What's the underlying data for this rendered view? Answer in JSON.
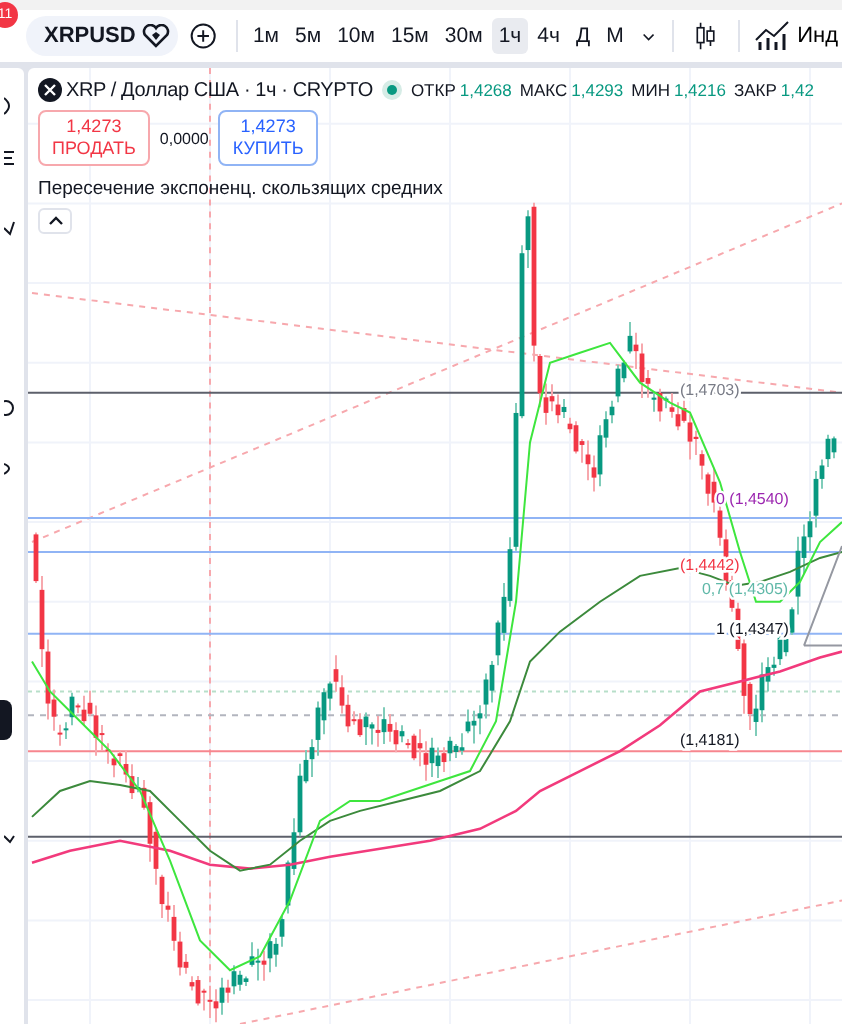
{
  "toolbar": {
    "notification_badge": "11",
    "symbol": "XRPUSD",
    "intervals": [
      {
        "label": "1м",
        "selected": false
      },
      {
        "label": "5м",
        "selected": false
      },
      {
        "label": "10м",
        "selected": false
      },
      {
        "label": "15м",
        "selected": false
      },
      {
        "label": "30м",
        "selected": false
      },
      {
        "label": "1ч",
        "selected": true
      },
      {
        "label": "4ч",
        "selected": false
      },
      {
        "label": "Д",
        "selected": false
      },
      {
        "label": "М",
        "selected": false
      }
    ],
    "indicators_button": "Инд"
  },
  "legend": {
    "title": "XRP / Доллар США · 1ч · CRYPTO",
    "ohlc": [
      {
        "label": "ОТКР",
        "value": "1,4268"
      },
      {
        "label": "МАКС",
        "value": "1,4293"
      },
      {
        "label": "МИН",
        "value": "1,4216"
      },
      {
        "label": "ЗАКР",
        "value": "1,42"
      }
    ]
  },
  "trade": {
    "sell": {
      "price": "1,4273",
      "label": "ПРОДАТЬ"
    },
    "spread": "0,0000",
    "buy": {
      "price": "1,4273",
      "label": "КУПИТЬ"
    }
  },
  "indicator_label": "Пересечение экспоненц. скользящих средних",
  "chart_labels": [
    {
      "text": "(1,4703)",
      "color": "#787b86"
    },
    {
      "text": "0 (1,4540)",
      "color": "#9c27b0"
    },
    {
      "text": "(1,4442)",
      "color": "#f23645"
    },
    {
      "text": "0,7 (1,4305)",
      "color": "#5fb8a8"
    },
    {
      "text": "1 (1,4347)",
      "color": "#131722"
    },
    {
      "text": "(1,4181)",
      "color": "#131722"
    }
  ]
}
